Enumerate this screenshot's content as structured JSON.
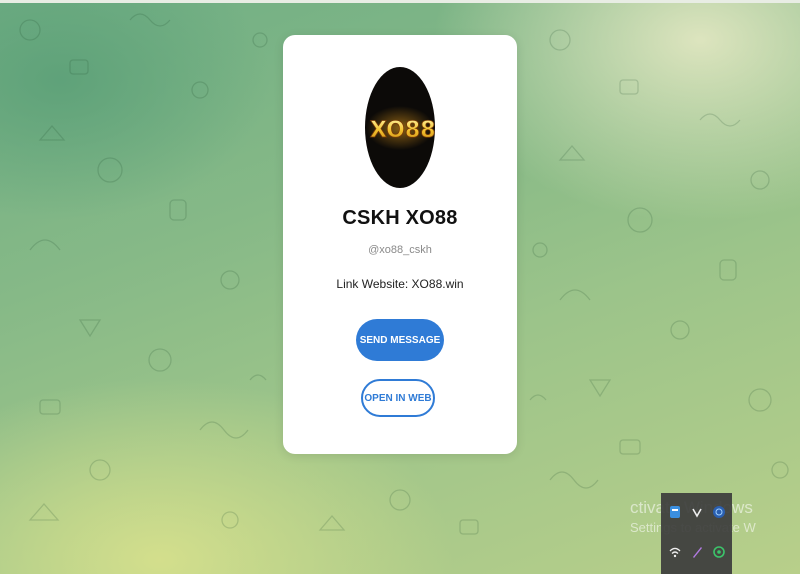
{
  "profile": {
    "logo_text": "XO88",
    "name": "CSKH XO88",
    "username": "@xo88_cskh",
    "description": "Link Website: XO88.win"
  },
  "actions": {
    "send_message": "SEND MESSAGE",
    "open_in_web": "OPEN IN WEB"
  },
  "system_overlay": {
    "activation_line1": "ctivate Windows",
    "activation_line2": "Settings to activate W",
    "tray_icons": [
      "app-icon",
      "chevron-icon",
      "globe-icon",
      "wifi-icon",
      "pen-icon",
      "location-icon"
    ]
  },
  "colors": {
    "accent": "#2f7bd6",
    "card_bg": "#ffffff",
    "logo_bg": "#0c0a08",
    "logo_gold": "#f2c12e",
    "logo_red": "#d8201e"
  }
}
